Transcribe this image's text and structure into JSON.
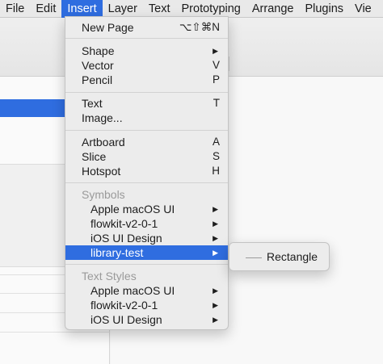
{
  "menubar": [
    "File",
    "Edit",
    "Insert",
    "Layer",
    "Text",
    "Prototyping",
    "Arrange",
    "Plugins",
    "Vie"
  ],
  "menubar_active": "Insert",
  "insert_menu": {
    "new_page": {
      "label": "New Page",
      "shortcut": "⌥⇧⌘N"
    },
    "shape": {
      "label": "Shape",
      "arrow": "▶"
    },
    "vector": {
      "label": "Vector",
      "shortcut": "V"
    },
    "pencil": {
      "label": "Pencil",
      "shortcut": "P"
    },
    "text": {
      "label": "Text",
      "shortcut": "T"
    },
    "image": {
      "label": "Image..."
    },
    "artboard": {
      "label": "Artboard",
      "shortcut": "A"
    },
    "slice": {
      "label": "Slice",
      "shortcut": "S"
    },
    "hotspot": {
      "label": "Hotspot",
      "shortcut": "H"
    },
    "symbols_header": "Symbols",
    "symbols": [
      {
        "label": "Apple macOS UI",
        "arrow": "▶"
      },
      {
        "label": "flowkit-v2-0-1",
        "arrow": "▶"
      },
      {
        "label": "iOS UI Design",
        "arrow": "▶"
      },
      {
        "label": "library-test",
        "arrow": "▶"
      }
    ],
    "text_styles_header": "Text Styles",
    "text_styles": [
      {
        "label": "Apple macOS UI",
        "arrow": "▶"
      },
      {
        "label": "flowkit-v2-0-1",
        "arrow": "▶"
      },
      {
        "label": "iOS UI Design",
        "arrow": "▶"
      }
    ]
  },
  "submenu": {
    "label": "Rectangle",
    "icon": "rectangle-line-icon"
  },
  "colors": {
    "highlight": "#2f6de0",
    "menu_bg": "#ececec",
    "header_text": "#9a9a9a"
  }
}
